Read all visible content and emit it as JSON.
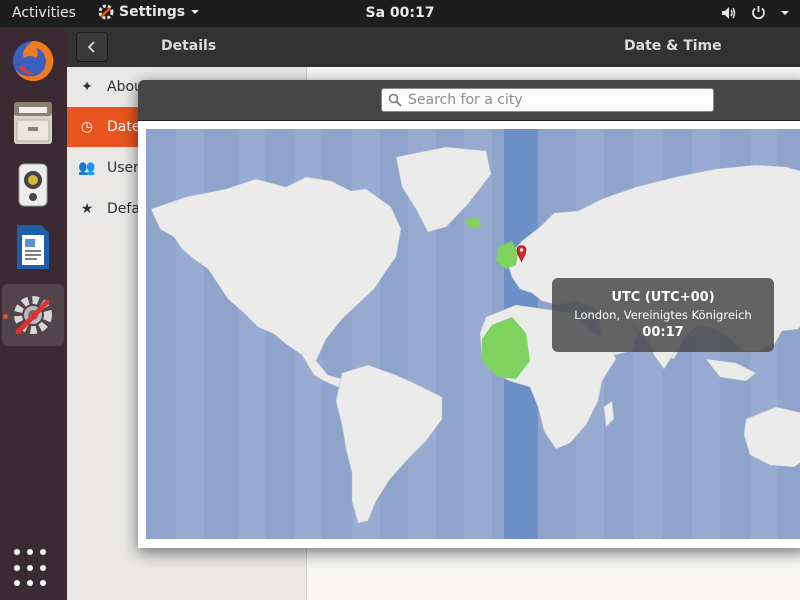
{
  "topbar": {
    "activities": "Activities",
    "app_name": "Settings",
    "clock": "Sa 00:17"
  },
  "dock": {
    "items": [
      "firefox",
      "files",
      "rhythmbox",
      "libreoffice-writer",
      "settings"
    ]
  },
  "settings": {
    "header_left": "Details",
    "header_right": "Date & Time",
    "sidebar": [
      {
        "label": "About",
        "icon": "star-icon"
      },
      {
        "label": "Date & Time",
        "icon": "clock-icon"
      },
      {
        "label": "Users",
        "icon": "users-icon"
      },
      {
        "label": "Default Applications",
        "icon": "star-icon"
      }
    ]
  },
  "dialog": {
    "search_placeholder": "Search for a city"
  },
  "timezone": {
    "name": "UTC (UTC+00)",
    "city": "London, Vereinigtes Königreich",
    "time": "00:17"
  },
  "colors": {
    "accent": "#e95420",
    "ocean": "#8fa4cb",
    "land": "#ecebeb",
    "selected_zone": "#6e90c9",
    "selected_land": "#7fd160"
  }
}
